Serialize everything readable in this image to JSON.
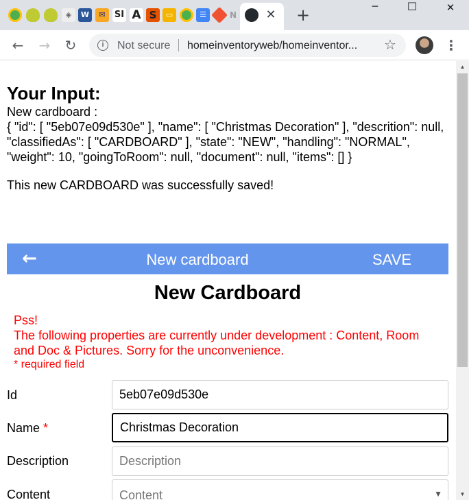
{
  "browser": {
    "window_controls": {
      "minimize": "─",
      "maximize": "☐",
      "close": "✕"
    },
    "tabs": [
      {
        "icon": "chrome-circle-icon",
        "color": "#4caf50",
        "glyph": ""
      },
      {
        "icon": "shield-yellow-icon",
        "color": "#c0ca33",
        "glyph": ""
      },
      {
        "icon": "shield-yellow-icon",
        "color": "#c0ca33",
        "glyph": ""
      },
      {
        "icon": "diamond-icon",
        "color": "#9e9e9e",
        "glyph": "◈"
      },
      {
        "icon": "word-icon",
        "color": "#2b579a",
        "glyph": "W"
      },
      {
        "icon": "mail-icon",
        "color": "#f9a825",
        "glyph": "✉"
      },
      {
        "icon": "si-icon",
        "color": "#212121",
        "glyph": "SI"
      },
      {
        "icon": "letter-a-icon",
        "color": "#424242",
        "glyph": "A"
      },
      {
        "icon": "letter-s-icon",
        "color": "#e65100",
        "glyph": "S"
      },
      {
        "icon": "slides-icon",
        "color": "#f4b400",
        "glyph": "▭"
      },
      {
        "icon": "chrome-circle-icon",
        "color": "#4caf50",
        "glyph": ""
      },
      {
        "icon": "docs-icon",
        "color": "#4285f4",
        "glyph": "☰"
      },
      {
        "icon": "git-icon",
        "color": "#f05133",
        "glyph": "◆"
      },
      {
        "icon": "n-icon",
        "color": "#bdbdbd",
        "glyph": "N"
      },
      {
        "icon": "github-icon",
        "color": "#24292e",
        "glyph": "●"
      }
    ],
    "tab_close": "✕",
    "new_tab": "+",
    "nav": {
      "back": "←",
      "forward": "→",
      "reload": "↻"
    },
    "security_label": "Not secure",
    "url": "homeinventoryweb/homeinventor...",
    "bookmark": "☆",
    "menu": "⋮"
  },
  "page": {
    "input_title": "Your Input:",
    "raw_label": "New cardboard :",
    "raw_json": "{ \"id\": [ \"5eb07e09d530e\" ], \"name\": [ \"Christmas Decoration\" ], \"descrition\": null, \"classifiedAs\": [ \"CARDBOARD\" ], \"state\": \"NEW\", \"handling\": \"NORMAL\", \"weight\": 10, \"goingToRoom\": null, \"document\": null, \"items\": [] }",
    "saved_message": "This new CARDBOARD was successfully saved!",
    "appbar": {
      "back": "🡐",
      "title": "New cardboard",
      "save": "SAVE",
      "color": "#6495ed"
    },
    "form_title": "New Cardboard",
    "warning": {
      "line1": "Pss!",
      "line2": "The following properties are currently under development : Content, Room and Doc & Pictures. Sorry for the unconvenience.",
      "color": "#ff0000"
    },
    "required_note": "* required field",
    "fields": {
      "id": {
        "label": "Id",
        "value": "5eb07e09d530e"
      },
      "name": {
        "label": "Name",
        "required_mark": "*",
        "value": "Christmas Decoration"
      },
      "description": {
        "label": "Description",
        "placeholder": "Description"
      },
      "content": {
        "label": "Content",
        "placeholder": "Content",
        "arrow": "▼"
      }
    }
  }
}
